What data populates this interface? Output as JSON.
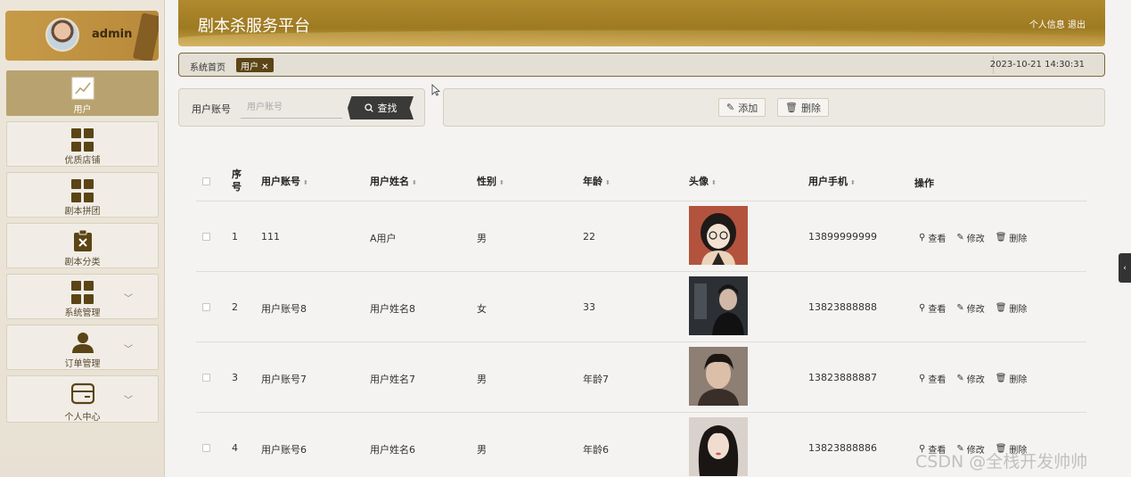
{
  "user": {
    "name": "admin"
  },
  "sidebar": {
    "items": [
      {
        "label": "用户"
      },
      {
        "label": "优质店铺"
      },
      {
        "label": "剧本拼团"
      },
      {
        "label": "剧本分类"
      },
      {
        "label": "系统管理"
      },
      {
        "label": "订单管理"
      },
      {
        "label": "个人中心"
      }
    ]
  },
  "header": {
    "title": "剧本杀服务平台",
    "profile_link": "个人信息",
    "logout_link": "退出"
  },
  "tabbar": {
    "home": "系统首页",
    "active_tab": "用户 ✕",
    "datetime": "2023-10-21 14:30:31"
  },
  "search": {
    "label": "用户账号",
    "placeholder": "用户账号",
    "button": "查找"
  },
  "actions": {
    "add": "添加",
    "delete": "删除"
  },
  "table": {
    "headers": {
      "index_line1": "序",
      "index_line2": "号",
      "account": "用户账号",
      "name": "用户姓名",
      "gender": "性别",
      "age": "年龄",
      "avatar": "头像",
      "phone": "用户手机",
      "ops": "操作"
    },
    "ops": {
      "view": "查看",
      "edit": "修改",
      "delete": "删除"
    },
    "rows": [
      {
        "index": "1",
        "account": "111",
        "name": "A用户",
        "gender": "男",
        "age": "22",
        "phone": "13899999999"
      },
      {
        "index": "2",
        "account": "用户账号8",
        "name": "用户姓名8",
        "gender": "女",
        "age": "33",
        "phone": "13823888888"
      },
      {
        "index": "3",
        "account": "用户账号7",
        "name": "用户姓名7",
        "gender": "男",
        "age": "年龄7",
        "phone": "13823888887"
      },
      {
        "index": "4",
        "account": "用户账号6",
        "name": "用户姓名6",
        "gender": "男",
        "age": "年龄6",
        "phone": "13823888886"
      }
    ]
  },
  "watermark": "CSDN @全栈开发帅帅",
  "colors": {
    "accent": "#5b4415",
    "header": "#a8842a",
    "sidebar_active": "#b8a370"
  }
}
